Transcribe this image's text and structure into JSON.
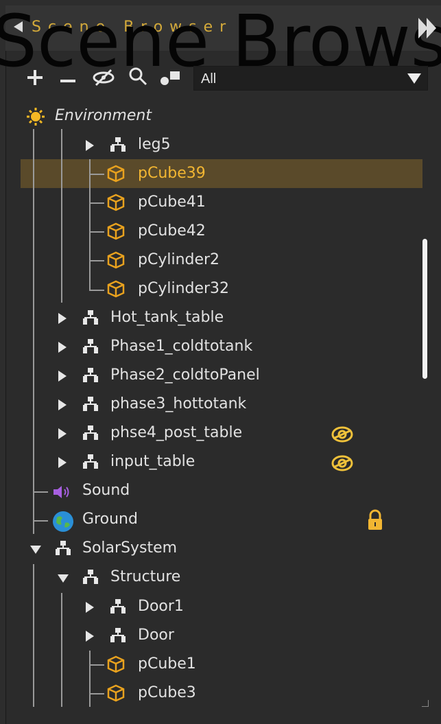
{
  "panel": {
    "title_small": "Scene Browser",
    "title_overlay": "Scene Brows"
  },
  "toolbar": {
    "add": "add-icon",
    "remove": "remove-icon",
    "visibility": "eye-icon",
    "search": "search-icon",
    "link": "link-icon",
    "filter_value": "All"
  },
  "colors": {
    "background": "#2b2b2b",
    "selection": "#5a4a2a",
    "accent": "#f2b632",
    "text": "#e2e2e2"
  },
  "tree": {
    "environment": "Environment",
    "leg5": "leg5",
    "pCube39": "pCube39",
    "pCube41": "pCube41",
    "pCube42": "pCube42",
    "pCylinder2": "pCylinder2",
    "pCylinder32": "pCylinder32",
    "hot_tank_table": "Hot_tank_table",
    "phase1": "Phase1_coldtotank",
    "phase2": "Phase2_coldtoPanel",
    "phase3": "phase3_hottotank",
    "phse4": "phse4_post_table",
    "input_table": "input_table",
    "sound": "Sound",
    "ground": "Ground",
    "solar_system": "SolarSystem",
    "structure": "Structure",
    "door1": "Door1",
    "door": "Door",
    "pCube1": "pCube1",
    "pCube3": "pCube3"
  }
}
